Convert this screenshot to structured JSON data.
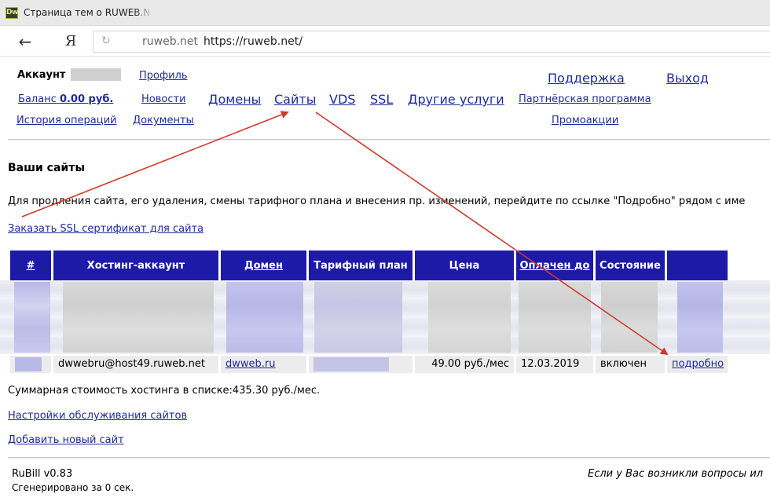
{
  "browser": {
    "favicon": "Dw",
    "tab_title": "Страница тем о RUWEB.NET",
    "back_icon": "←",
    "yandex_icon": "Я",
    "reload_icon": "↻",
    "url_host": "ruweb.net",
    "url_full": "https://ruweb.net/"
  },
  "header": {
    "account_label": "Аккаунт",
    "profile": "Профиль",
    "balance_prefix": "Баланс",
    "balance_value": "0.00 руб.",
    "news": "Новости",
    "history": "История операций",
    "documents": "Документы",
    "domains": "Домены",
    "sites": "Сайты",
    "vds": "VDS",
    "ssl": "SSL",
    "other_services": "Другие услуги",
    "support": "Поддержка",
    "logout": "Выход",
    "partner": "Партнёрская программа",
    "promo": "Промоакции"
  },
  "main": {
    "heading": "Ваши сайты",
    "intro": "Для продления сайта, его удаления, смены тарифного плана и внесения пр. изменений, перейдите по ссылке \"Подробно\" рядом с име",
    "ssl_link": "Заказать SSL сертификат для сайта",
    "table": {
      "headers": [
        "#",
        "Хостинг-аккаунт",
        "Домен",
        "Тарифный план",
        "Цена",
        "Оплачен до",
        "Состояние",
        ""
      ],
      "visible_row": {
        "account": "dwwebru@host49.ruweb.net",
        "domain": "dwweb.ru",
        "price": "49.00 руб./мес",
        "paid_until": "12.03.2019",
        "status": "включен",
        "details": "подробно"
      }
    },
    "total": "Суммарная стоимость хостинга в списке:435.30 руб./мес.",
    "service_settings": "Настройки обслуживания сайтов",
    "add_site": "Добавить новый сайт"
  },
  "footer": {
    "version": "RuBill v0.83",
    "generated": "Сгенерировано за 0 сек.",
    "question": "Если у Вас возникли вопросы ил"
  },
  "colors": {
    "link": "#1f2a9c",
    "table_header": "#1d1aa8",
    "annotation_arrow": "#d2382c"
  }
}
